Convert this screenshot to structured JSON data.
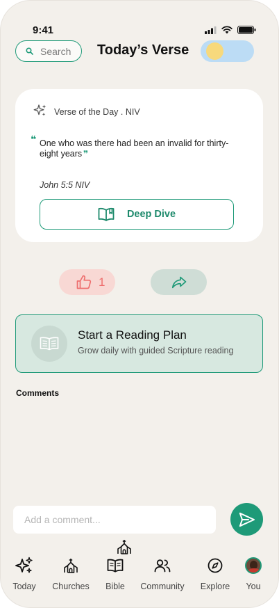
{
  "status_bar": {
    "time": "9:41"
  },
  "header": {
    "search_placeholder": "Search",
    "title": "Today’s Verse"
  },
  "verse_card": {
    "label": "Verse of the Day . NIV",
    "text": "One who was there had been an invalid for thirty-eight years",
    "reference": "John 5:5 NIV",
    "deep_dive_label": "Deep Dive"
  },
  "actions": {
    "like_count": "1"
  },
  "reading_plan": {
    "title": "Start a Reading Plan",
    "subtitle": "Grow daily with guided Scripture reading"
  },
  "comments": {
    "heading": "Comments",
    "input_placeholder": "Add a comment..."
  },
  "nav": {
    "items": [
      {
        "label": "Today",
        "icon": "sparkles-icon"
      },
      {
        "label": "Churches",
        "icon": "church-icon"
      },
      {
        "label": "Bible",
        "icon": "open-book-icon"
      },
      {
        "label": "Community",
        "icon": "people-icon"
      },
      {
        "label": "Explore",
        "icon": "compass-icon"
      },
      {
        "label": "You",
        "icon": "avatar"
      }
    ]
  },
  "colors": {
    "accent": "#1e9a78",
    "background": "#f3f0eb",
    "like": "#ee6e6e",
    "toggle_track": "#bcdcf5",
    "toggle_knob": "#f7d97c"
  }
}
